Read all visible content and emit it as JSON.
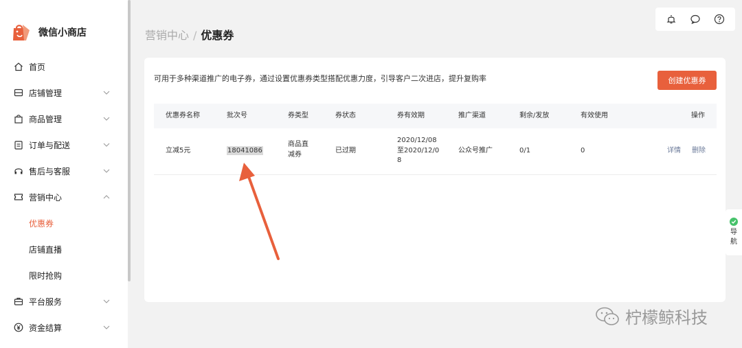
{
  "app": {
    "name": "微信小商店"
  },
  "sidebar": {
    "items": [
      {
        "label": "首页",
        "icon": "home-icon"
      },
      {
        "label": "店铺管理",
        "icon": "shop-icon"
      },
      {
        "label": "商品管理",
        "icon": "bag-icon"
      },
      {
        "label": "订单与配送",
        "icon": "order-icon"
      },
      {
        "label": "售后与客服",
        "icon": "headset-icon"
      },
      {
        "label": "营销中心",
        "icon": "ticket-icon"
      }
    ],
    "sub_items": [
      {
        "label": "优惠券"
      },
      {
        "label": "店铺直播"
      },
      {
        "label": "限时抢购"
      }
    ],
    "bottom_items": [
      {
        "label": "平台服务",
        "icon": "briefcase-icon"
      },
      {
        "label": "资金结算",
        "icon": "yen-icon"
      }
    ]
  },
  "breadcrumb": {
    "parent": "营销中心",
    "separator": "/",
    "current": "优惠券"
  },
  "main": {
    "description": "可用于多种渠道推广的电子券，通过设置优惠券类型搭配优惠力度，引导客户二次进店，提升复购率",
    "create_button": "创建优惠券"
  },
  "table": {
    "columns": [
      "优惠券名称",
      "批次号",
      "券类型",
      "券状态",
      "券有效期",
      "推广渠道",
      "剩余/发放",
      "有效使用",
      "操作"
    ],
    "rows": [
      {
        "name": "立减5元",
        "batch": "18041086",
        "type_line1": "商品直",
        "type_line2": "减券",
        "status": "已过期",
        "validity_line1": "2020/12/08",
        "validity_line2": "至2020/12/0",
        "validity_line3": "8",
        "channel": "公众号推广",
        "remaining": "0/1",
        "used": "0",
        "action_detail": "详情",
        "action_delete": "删除"
      }
    ]
  },
  "nav_widget": {
    "line1": "导",
    "line2": "航"
  },
  "watermark": {
    "text": "柠檬鲸科技"
  },
  "colors": {
    "accent": "#e8603c",
    "link": "#6b7a99",
    "nav_dot": "#46c26a"
  }
}
